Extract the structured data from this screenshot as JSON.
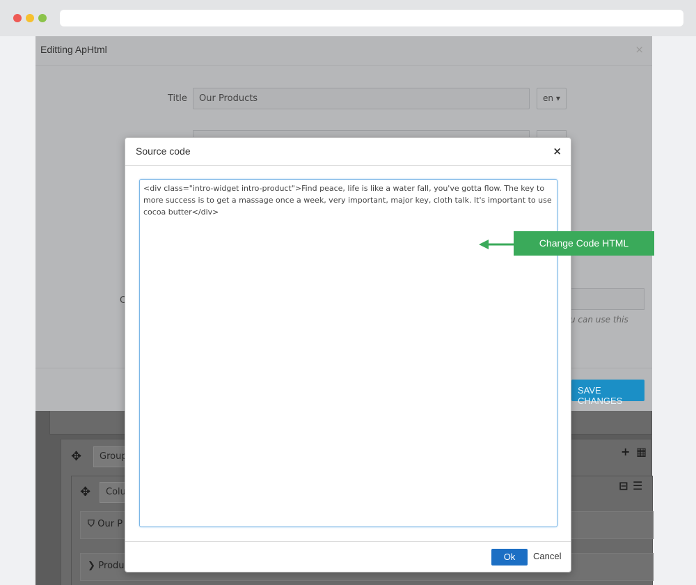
{
  "browser": {
    "dots": [
      "close",
      "minimize",
      "maximize"
    ]
  },
  "edit_modal": {
    "title": "Editting ApHtml",
    "close_icon": "×",
    "title_label": "Title",
    "title_value": "Our Products",
    "lang_value": "en",
    "c_label": "C",
    "help_text": "u can use this",
    "save_button": "SAVE CHANGES"
  },
  "background": {
    "group_input": "Group",
    "column_input": "Colu",
    "item_our": "Our P",
    "item_prod": "Produ"
  },
  "source_modal": {
    "title": "Source code",
    "close_icon": "×",
    "code": "<div class=\"intro-widget intro-product\">Find peace, life is like a water fall, you've gotta flow. The key to more success is to get a massage once a week, very important, major key, cloth talk. It's important to use cocoa butter</div>",
    "ok_button": "Ok",
    "cancel_button": "Cancel"
  },
  "callout": {
    "label": "Change Code HTML",
    "color": "#3aaa5a"
  },
  "colors": {
    "primary": "#1c6fc4",
    "save": "#1b8fc6"
  }
}
